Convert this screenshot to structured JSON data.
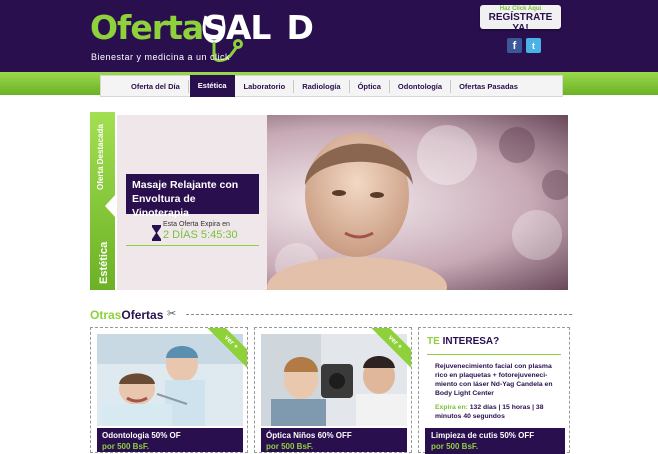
{
  "header": {
    "logo_part1": "Oferta",
    "logo_part2": "SAL",
    "logo_part3": "D",
    "tagline": "Bienestar y medicina a un click",
    "register_small": "Haz Click Aquí",
    "register_big": "REGÍSTRATE YA!",
    "social": [
      {
        "icon": "facebook-icon",
        "glyph": "f"
      },
      {
        "icon": "twitter-icon",
        "glyph": "t"
      }
    ]
  },
  "nav": {
    "items": [
      {
        "label": "Oferta del Día",
        "active": false
      },
      {
        "label": "Estética",
        "active": true
      },
      {
        "label": "Laboratorio",
        "active": false
      },
      {
        "label": "Radiología",
        "active": false
      },
      {
        "label": "Óptica",
        "active": false
      },
      {
        "label": "Odontología",
        "active": false
      },
      {
        "label": "Ofertas Pasadas",
        "active": false
      }
    ]
  },
  "featured": {
    "tab_label": "Oferta Destacada",
    "category": "Estética",
    "title": "Masaje Relajante con Envoltura de Vinoterapia",
    "expires_label": "Esta Oferta Expira en",
    "expires_value": "2 DÍAS 5:45:30"
  },
  "otras": {
    "title_part1": "Otras",
    "title_part2": "Ofertas",
    "ribbon": "ver +",
    "cards": [
      {
        "name": "Odontologia 50% OF",
        "price": "por 500 BsF."
      },
      {
        "name": "Óptica Niños 60% OFF",
        "price": "por 500 BsF."
      }
    ],
    "interest": {
      "title_part1": "TE",
      "title_part2": "INTERESA?",
      "body": "Rejuvenecimiento facial con plasma rico en plaquetas + fotorejuveneci-miento con láser Nd-Yag Candela en Body Light Center",
      "expires_label": "Expira en:",
      "expires_value": "132 días | 15 horas | 38 minutos 40 segundos",
      "offer_name": "Limpieza de cutis 50% OFF",
      "price": "por 500 BsF."
    }
  },
  "colors": {
    "purple": "#2a0f4e",
    "green": "#8ed13b"
  }
}
